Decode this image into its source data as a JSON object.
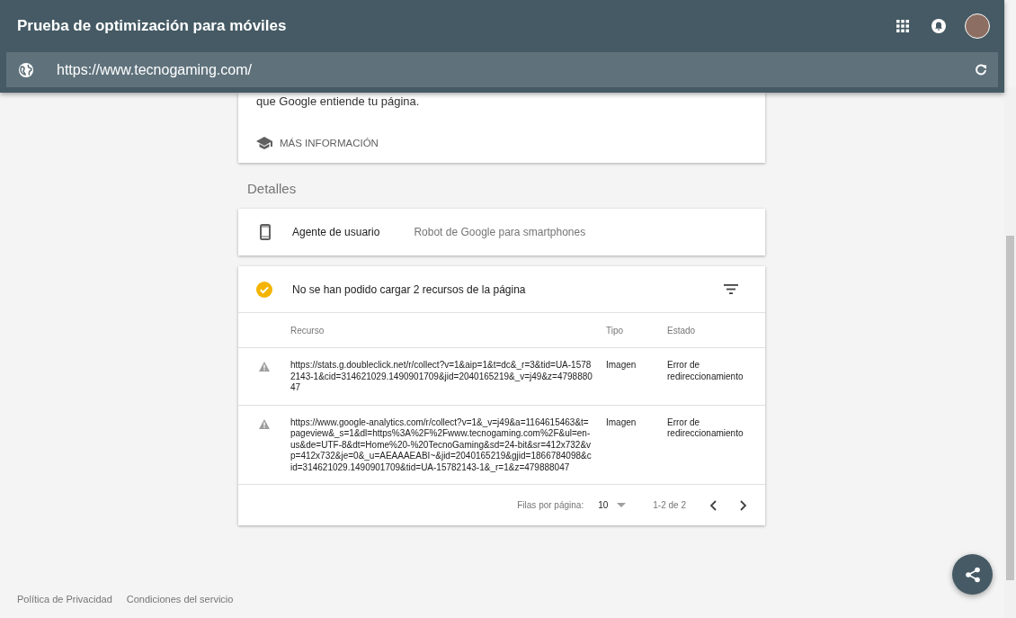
{
  "app_bar": {
    "title": "Prueba de optimización para móviles"
  },
  "url_bar": {
    "value": "https://www.tecnogaming.com/"
  },
  "info_card": {
    "text": "que Google entiende tu página.",
    "link": "MÁS INFORMACIÓN"
  },
  "section_title": "Detalles",
  "user_agent": {
    "label": "Agente de usuario",
    "value": "Robot de Google para smartphones"
  },
  "resources": {
    "title": "No se han podido cargar 2 recursos de la página",
    "columns": [
      "Recurso",
      "Tipo",
      "Estado"
    ],
    "rows": [
      {
        "resource": "https://stats.g.doubleclick.net/r/collect?v=1&aip=1&t=dc&_r=3&tid=UA-15782143-1&cid=314621029.1490901709&jid=2040165219&_v=j49&z=479888047",
        "type": "Imagen",
        "status": "Error de redireccionamiento"
      },
      {
        "resource": "https://www.google-analytics.com/r/collect?v=1&_v=j49&a=1164615463&t=pageview&_s=1&dl=https%3A%2F%2Fwww.tecnogaming.com%2F&ul=en-us&de=UTF-8&dt=Home%20-%20TecnoGaming&sd=24-bit&sr=412x732&vp=412x732&je=0&_u=AEAAAEABI~&jid=2040165219&gjid=1866784098&cid=314621029.1490901709&tid=UA-15782143-1&_r=1&z=479888047",
        "type": "Imagen",
        "status": "Error de redireccionamiento"
      }
    ],
    "pagination": {
      "rows_label": "Filas por página:",
      "rows_value": "10",
      "range": "1-2 de 2"
    }
  },
  "footer": [
    "Política de Privacidad",
    "Condiciones del servicio"
  ]
}
